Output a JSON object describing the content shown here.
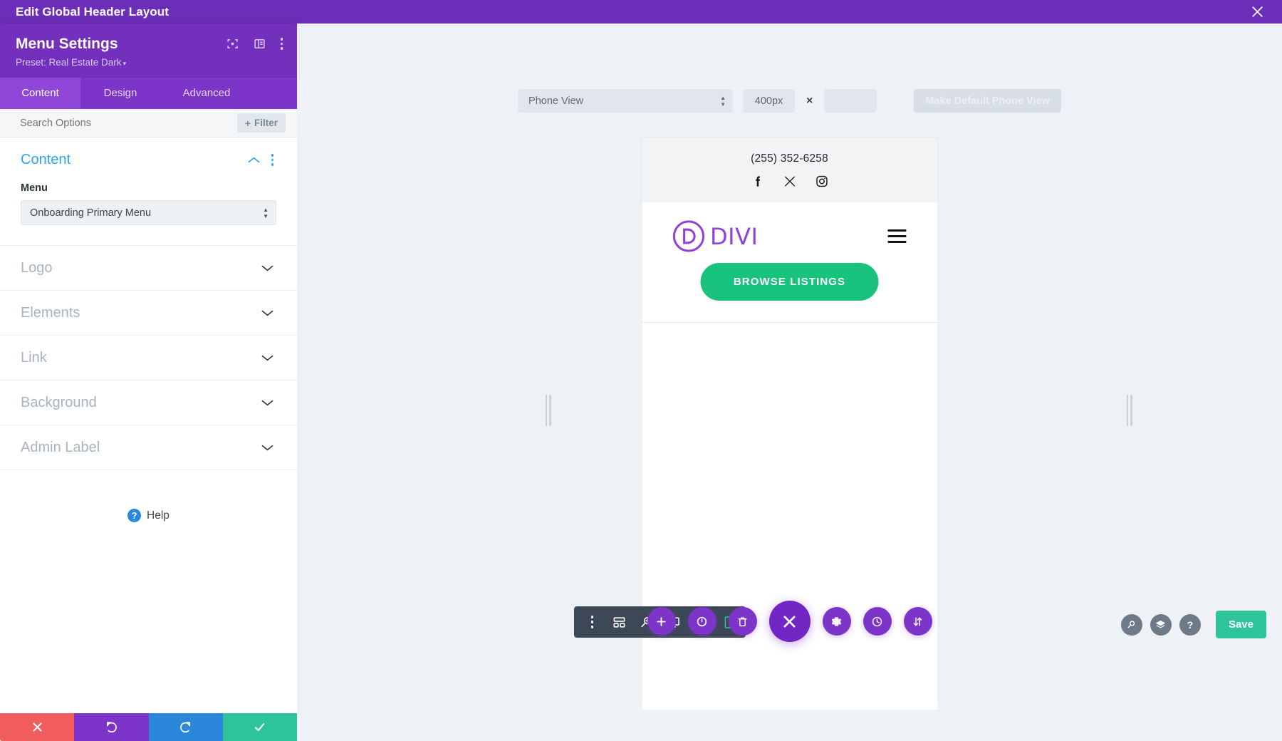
{
  "window": {
    "title": "Edit Global Header Layout",
    "close_icon": "close-icon"
  },
  "sidebar": {
    "module_title": "Menu Settings",
    "preset_label": "Preset: Real Estate Dark",
    "preset_caret": "▾",
    "header_icons": [
      {
        "name": "focus-module-icon"
      },
      {
        "name": "panel-layout-icon"
      },
      {
        "name": "more-options-icon"
      }
    ],
    "tabs": [
      {
        "label": "Content",
        "active": true
      },
      {
        "label": "Design",
        "active": false
      },
      {
        "label": "Advanced",
        "active": false
      }
    ],
    "search": {
      "placeholder": "Search Options",
      "value": ""
    },
    "filter_label": "Filter",
    "filter_plus": "+",
    "sections": [
      {
        "label": "Content",
        "open": true,
        "active": true
      },
      {
        "label": "Logo",
        "open": false,
        "active": false
      },
      {
        "label": "Elements",
        "open": false,
        "active": false
      },
      {
        "label": "Link",
        "open": false,
        "active": false
      },
      {
        "label": "Background",
        "open": false,
        "active": false
      },
      {
        "label": "Admin Label",
        "open": false,
        "active": false
      }
    ],
    "menu_field": {
      "label": "Menu",
      "value": "Onboarding Primary Menu"
    },
    "help": {
      "badge": "?",
      "label": "Help"
    },
    "actions": [
      {
        "name": "cancel-button",
        "icon": "close-icon",
        "color": "#f15d5d"
      },
      {
        "name": "undo-button",
        "icon": "undo-icon",
        "color": "#7c34c9"
      },
      {
        "name": "redo-button",
        "icon": "redo-icon",
        "color": "#2b87da"
      },
      {
        "name": "save-changes-button",
        "icon": "check-icon",
        "color": "#2dc49b"
      }
    ]
  },
  "view_toolbar": {
    "view_mode": "Phone View",
    "width_value": "400px",
    "height_value": "",
    "height_placeholder": "",
    "multiply_symbol": "×",
    "make_default_label": "Make Default Phone View"
  },
  "preview": {
    "phone_number": "(255) 352-6258",
    "social": [
      {
        "name": "facebook-icon"
      },
      {
        "name": "x-twitter-icon"
      },
      {
        "name": "instagram-icon"
      }
    ],
    "brand_name": "DIVI",
    "cta_label": "BROWSE LISTINGS",
    "menu_toggle": "hamburger-menu-icon"
  },
  "bottom_toolbar": {
    "items": [
      {
        "name": "toolbar-more-icon",
        "active": false
      },
      {
        "name": "wireframe-view-icon",
        "active": false
      },
      {
        "name": "zoom-view-icon",
        "active": false
      },
      {
        "name": "desktop-view-icon",
        "active": false
      },
      {
        "name": "tablet-view-icon",
        "active": false
      },
      {
        "name": "phone-view-icon",
        "active": true
      }
    ]
  },
  "center_bar": {
    "buttons": [
      {
        "name": "add-section-button",
        "icon": "plus-icon",
        "main": false
      },
      {
        "name": "page-settings-button",
        "icon": "power-icon",
        "main": false
      },
      {
        "name": "delete-button",
        "icon": "trash-icon",
        "main": false
      },
      {
        "name": "close-builder-button",
        "icon": "close-icon",
        "main": true
      },
      {
        "name": "settings-button",
        "icon": "gear-icon",
        "main": false
      },
      {
        "name": "history-button",
        "icon": "clock-icon",
        "main": false
      },
      {
        "name": "responsive-toggle-button",
        "icon": "sort-arrows-icon",
        "main": false
      }
    ]
  },
  "right_bar": {
    "buttons": [
      {
        "name": "search-button",
        "icon": "magnifier-icon"
      },
      {
        "name": "layers-button",
        "icon": "layers-icon"
      },
      {
        "name": "help-button",
        "icon": "question-icon"
      }
    ],
    "save_label": "Save"
  },
  "colors": {
    "brand_purple": "#7c34c9",
    "topbar_purple": "#6c2eb9",
    "accent_blue": "#2ea3f2",
    "green": "#2dc49b",
    "cta_green": "#19c37d",
    "divi_purple": "#9141d8",
    "red": "#f15d5d",
    "dark_slate": "#3c4856"
  }
}
